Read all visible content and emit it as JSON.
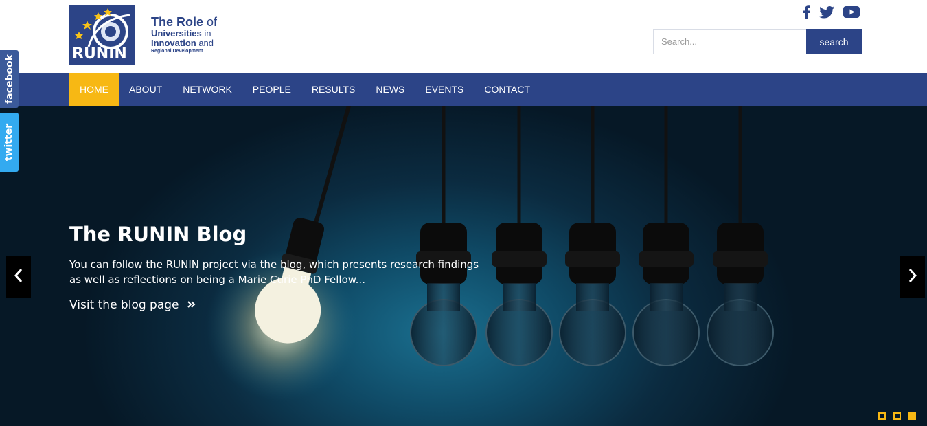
{
  "header": {
    "logo": {
      "mark_text": "RUNIN",
      "line1_bold": "The Role",
      "line1_rest": " of",
      "line2_bold": "Universities",
      "line2_rest": " in",
      "line3_bold": "Innovation",
      "line3_rest": " and",
      "line4": "Regional Development"
    },
    "social_icons": [
      "facebook-icon",
      "twitter-icon",
      "youtube-icon"
    ],
    "search": {
      "placeholder": "Search...",
      "button_label": "search"
    }
  },
  "nav": {
    "items": [
      {
        "label": "HOME",
        "active": true
      },
      {
        "label": "ABOUT",
        "active": false
      },
      {
        "label": "NETWORK",
        "active": false
      },
      {
        "label": "PEOPLE",
        "active": false
      },
      {
        "label": "RESULTS",
        "active": false
      },
      {
        "label": "NEWS",
        "active": false
      },
      {
        "label": "EVENTS",
        "active": false
      },
      {
        "label": "CONTACT",
        "active": false
      }
    ]
  },
  "side_tabs": {
    "facebook": "facebook",
    "twitter": "twitter"
  },
  "hero": {
    "title": "The RUNIN Blog",
    "description": "You can follow the RUNIN project via the blog, which presents research findings as well as reflections on being a Marie Curie PhD Fellow...",
    "link_label": "Visit the blog page",
    "link_icon": "double-chevron-right-icon",
    "slide_count": 3,
    "active_slide": 3
  },
  "colors": {
    "brand_blue": "#2c4487",
    "accent_yellow": "#f7b814",
    "facebook_blue": "#3b5a9a",
    "twitter_blue": "#33aaf0"
  }
}
